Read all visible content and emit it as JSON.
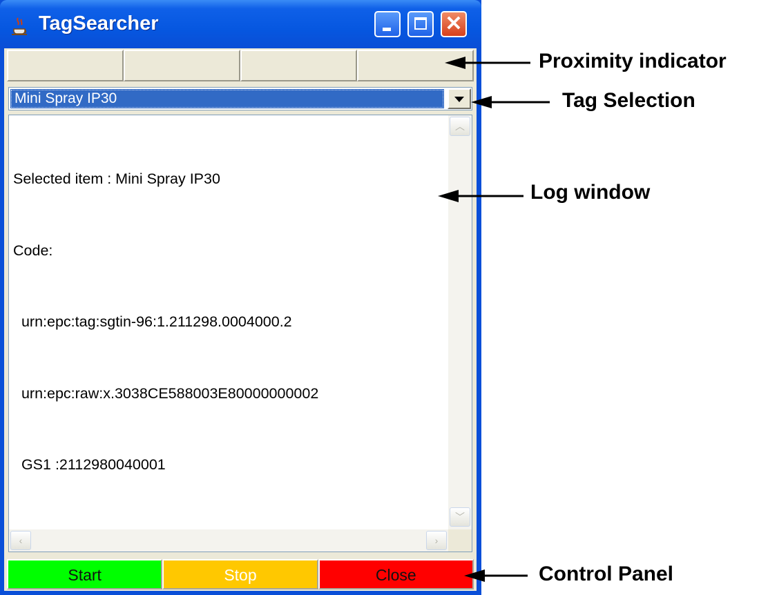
{
  "window": {
    "title": "TagSearcher"
  },
  "proximity": {
    "cells": 4
  },
  "tag_selection": {
    "selected": "Mini Spray IP30"
  },
  "log": {
    "lines": [
      "Selected item : Mini Spray IP30",
      "Code:",
      "  urn:epc:tag:sgtin-96:1.211298.0004000.2",
      "  urn:epc:raw:x.3038CE588003E80000000002",
      "  GS1 :2112980040001"
    ]
  },
  "control_panel": {
    "start_label": "Start",
    "stop_label": "Stop",
    "close_label": "Close",
    "start_color": "#00ff00",
    "stop_color": "#ffc800",
    "close_color": "#ff0000",
    "stop_text_color": "#ffffff"
  },
  "annotations": {
    "proximity": "Proximity indicator",
    "tag_selection": "Tag Selection",
    "log_window": "Log window",
    "control_panel": "Control Panel"
  }
}
